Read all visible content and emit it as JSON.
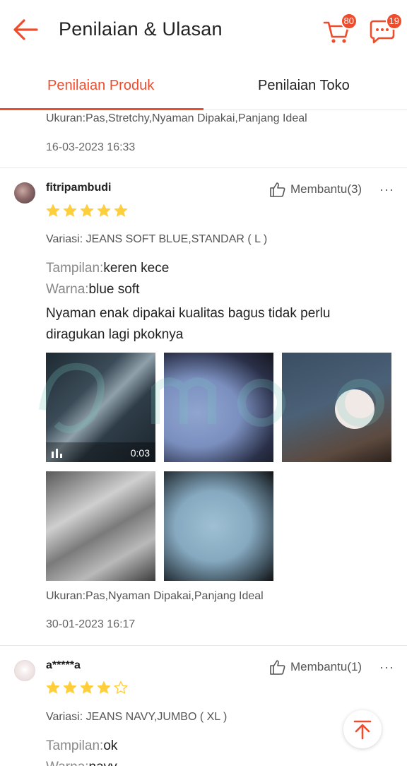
{
  "header": {
    "title": "Penilaian & Ulasan",
    "cart_count": "80",
    "chat_count": "19",
    "brand_color": "#ee4d2d"
  },
  "tabs": [
    {
      "label": "Penilaian Produk",
      "active": true
    },
    {
      "label": "Penilaian Toko",
      "active": false
    }
  ],
  "previous_review": {
    "sizes": "Ukuran:Pas,Stretchy,Nyaman Dipakai,Panjang Ideal",
    "date": "16-03-2023 16:33"
  },
  "reviews": [
    {
      "username": "fitripambudi",
      "helpful": "Membantu(3)",
      "more": "···",
      "rating": 5,
      "variation": "Variasi: JEANS SOFT BLUE,STANDAR ( L )",
      "attr1_label": "Tampilan:",
      "attr1_value": "keren kece",
      "attr2_label": "Warna:",
      "attr2_value": "blue soft",
      "comment": "Nyaman enak dipakai kualitas bagus tidak perlu diragukan lagi pkoknya",
      "video_duration": "0:03",
      "sizes": "Ukuran:Pas,Nyaman Dipakai,Panjang Ideal",
      "date": "30-01-2023 16:17"
    },
    {
      "username": "a*****a",
      "helpful": "Membantu(1)",
      "more": "···",
      "rating": 4,
      "variation": "Variasi: JEANS NAVY,JUMBO ( XL )",
      "attr1_label": "Tampilan:",
      "attr1_value": "ok",
      "attr2_label": "Warna:",
      "attr2_value": "navy"
    }
  ]
}
